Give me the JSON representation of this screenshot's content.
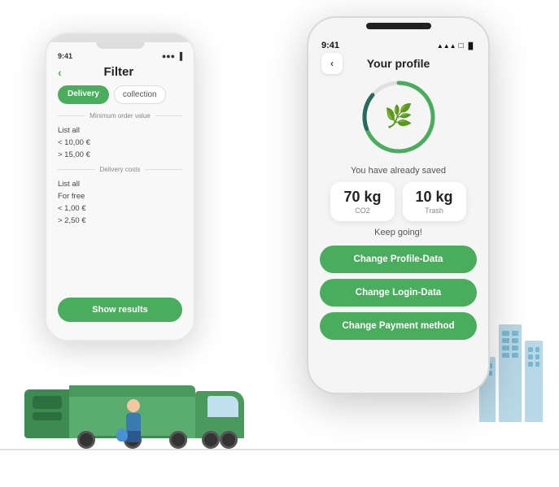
{
  "scene": {
    "background": "#ffffff"
  },
  "phone_left": {
    "status": {
      "time": "9:41",
      "signal": "●●●●"
    },
    "back_label": "‹",
    "title": "Filter",
    "tabs": [
      {
        "label": "Delivery",
        "active": true
      },
      {
        "label": "collection",
        "active": false
      }
    ],
    "section1_label": "Minimum order value",
    "section1_items": [
      "List all",
      "< 10,00 €",
      "> 15,00 €"
    ],
    "section2_label": "Delivery costs",
    "section2_items": [
      "List all",
      "For free",
      "< 1,00 €",
      "> 2,50 €"
    ],
    "show_results_label": "Show results"
  },
  "phone_right": {
    "status": {
      "time": "9:41",
      "icons": "▲▲▲ WiFi Batt"
    },
    "back_label": "‹",
    "title": "Your profile",
    "saved_text": "You have already saved",
    "stats": [
      {
        "value": "70 kg",
        "label": "CO2"
      },
      {
        "value": "10 kg",
        "label": "Trash"
      }
    ],
    "keep_going": "Keep going!",
    "buttons": [
      {
        "label": "Change Profile-Data"
      },
      {
        "label": "Change Login-Data"
      },
      {
        "label": "Change Payment method"
      }
    ]
  },
  "truck": {
    "color": "#5aad6e"
  },
  "building": {
    "color": "#b8d8e8"
  }
}
